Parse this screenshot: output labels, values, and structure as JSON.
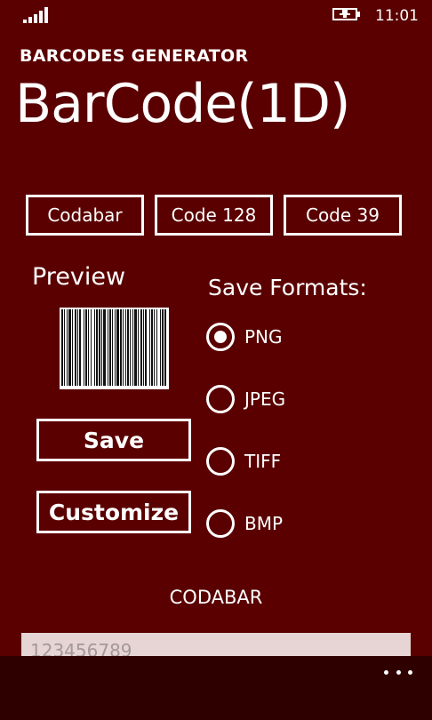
{
  "status": {
    "time": "11:01"
  },
  "app": {
    "name": "BARCODES GENERATOR",
    "title": "BarCode(1D)"
  },
  "types": [
    {
      "label": "Codabar"
    },
    {
      "label": "Code 128"
    },
    {
      "label": "Code 39"
    }
  ],
  "preview": {
    "label": "Preview"
  },
  "actions": {
    "save": "Save",
    "customize": "Customize"
  },
  "formats": {
    "label": "Save Formats:",
    "options": [
      {
        "label": "PNG",
        "selected": true
      },
      {
        "label": "JPEG",
        "selected": false
      },
      {
        "label": "TIFF",
        "selected": false
      },
      {
        "label": "BMP",
        "selected": false
      }
    ]
  },
  "current_type": "CODABAR",
  "input": {
    "value": "123456789"
  },
  "icons": {
    "signal": "signal-strength-icon",
    "battery": "battery-charging-icon",
    "more": "more-options-icon"
  }
}
